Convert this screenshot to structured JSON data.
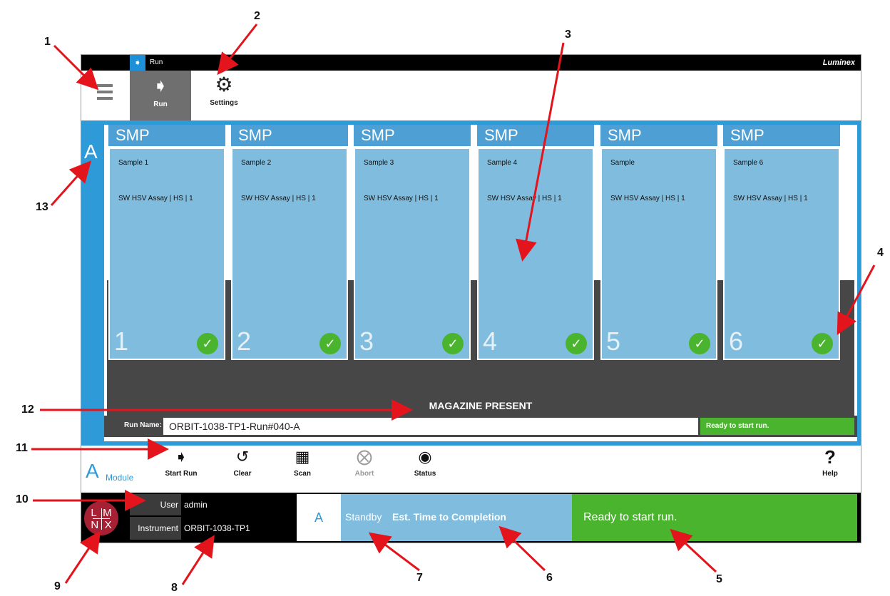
{
  "titlebar": {
    "label": "Run",
    "logo": "Luminex",
    "run_icon": "running-person-icon"
  },
  "toolbar": {
    "menu_icon": "hamburger-icon",
    "tabs": [
      {
        "label": "Run",
        "icon": "running-person-icon",
        "active": true
      },
      {
        "label": "Settings",
        "icon": "gear-icon",
        "active": false
      }
    ]
  },
  "module": {
    "letter": "A",
    "magazine_status": "MAGAZINE PRESENT",
    "run_name_label": "Run Name:",
    "run_name": "ORBIT-1038-TP1-Run#040-A",
    "run_status": "Ready to start run.",
    "cards": [
      {
        "type": "SMP",
        "sample": "Sample 1",
        "assay": "SW HSV Assay | HS | 1",
        "position": "1",
        "check_icon": "check-circle-icon"
      },
      {
        "type": "SMP",
        "sample": "Sample 2",
        "assay": "SW HSV Assay | HS | 1",
        "position": "2",
        "check_icon": "check-circle-icon"
      },
      {
        "type": "SMP",
        "sample": "Sample 3",
        "assay": "SW HSV Assay | HS | 1",
        "position": "3",
        "check_icon": "check-circle-icon"
      },
      {
        "type": "SMP",
        "sample": "Sample 4",
        "assay": "SW HSV Assay | HS | 1",
        "position": "4",
        "check_icon": "check-circle-icon"
      },
      {
        "type": "SMP",
        "sample": "Sample",
        "assay": "SW HSV Assay | HS | 1",
        "position": "5",
        "check_icon": "check-circle-icon"
      },
      {
        "type": "SMP",
        "sample": "Sample 6",
        "assay": "SW HSV Assay | HS | 1",
        "position": "6",
        "check_icon": "check-circle-icon"
      }
    ]
  },
  "actionbar": {
    "letter": "A",
    "module_label": "Module",
    "actions": [
      {
        "label": "Start Run",
        "icon": "running-person-icon",
        "enabled": true
      },
      {
        "label": "Clear",
        "icon": "undo-icon",
        "enabled": true
      },
      {
        "label": "Scan",
        "icon": "qr-code-icon",
        "enabled": true
      },
      {
        "label": "Abort",
        "icon": "close-circle-icon",
        "enabled": false
      },
      {
        "label": "Status",
        "icon": "eye-icon",
        "enabled": true
      },
      {
        "label": "Help",
        "icon": "question-mark-icon",
        "enabled": true
      }
    ]
  },
  "footer": {
    "logo_text": [
      "L",
      "M",
      "N",
      "X"
    ],
    "user_label": "User",
    "user_value": "admin",
    "instrument_label": "Instrument",
    "instrument_value": "ORBIT-1038-TP1",
    "module_letter": "A",
    "standby": "Standby",
    "est_time_label": "Est. Time to Completion",
    "ready_text": "Ready to start run."
  },
  "callouts": [
    "1",
    "2",
    "3",
    "4",
    "5",
    "6",
    "7",
    "8",
    "9",
    "10",
    "11",
    "12",
    "13"
  ],
  "colors": {
    "accent_blue": "#2e9ad8",
    "card_blue": "#7fbcdd",
    "card_header": "#4d9fd4",
    "ready_green": "#4bb42f",
    "dark_gray": "#474747",
    "logo_red": "#a62133",
    "arrow_red": "#e3141b"
  }
}
